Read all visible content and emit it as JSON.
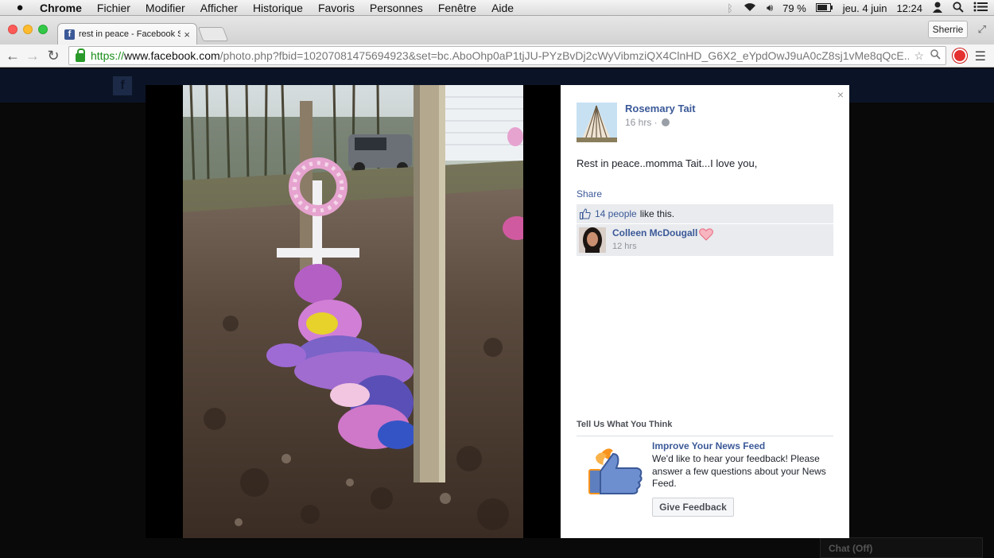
{
  "menubar": {
    "apple": "",
    "items": [
      "Chrome",
      "Fichier",
      "Modifier",
      "Afficher",
      "Historique",
      "Favoris",
      "Personnes",
      "Fenêtre",
      "Aide"
    ],
    "battery": "79 %",
    "date": "jeu. 4 juin",
    "time": "12:24"
  },
  "browser": {
    "tab_title": "rest in peace - Facebook S",
    "profile": "Sherrie",
    "url_https": "https://",
    "url_host": "www.facebook.com",
    "url_path": "/photo.php?fbid=10207081475694923&set=bc.AboOhp0aP1tjJU-PYzBvDj2cWyVibmziQX4ClnHD_G6X2_eYpdOwJ9uA0cZ8sj1vMe8qQcE..."
  },
  "post": {
    "author": "Rosemary Tait",
    "time": "16 hrs ·",
    "caption": "Rest in peace..momma Tait...I love you,",
    "share": "Share",
    "likes_count": "14 people",
    "likes_suffix": "like this."
  },
  "comment": {
    "name": "Colleen McDougall",
    "time": "12 hrs"
  },
  "feedback": {
    "heading": "Tell Us What You Think",
    "title": "Improve Your News Feed",
    "text": "We'd like to hear your feedback! Please answer a few questions about your News Feed.",
    "button": "Give Feedback"
  },
  "page": {
    "chat": "Chat (Off)"
  }
}
